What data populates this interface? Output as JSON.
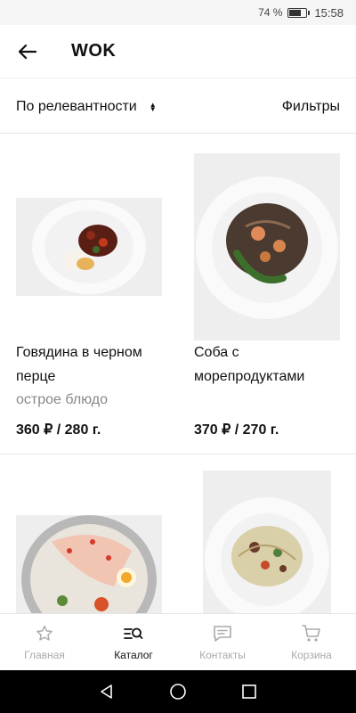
{
  "status_bar": {
    "battery_pct": "74 %",
    "battery_level": 0.74,
    "time": "15:58"
  },
  "header": {
    "title": "WOK"
  },
  "sort": {
    "label": "По релевантности",
    "filters_label": "Фильтры"
  },
  "products": [
    {
      "title_line1": "Говядина в черном",
      "title_line2": "перце",
      "subtitle": "острое блюдо",
      "price": "360 ₽ / 280 г."
    },
    {
      "title_line1": "Соба с",
      "title_line2": "морепродуктами",
      "subtitle": "",
      "price": "370 ₽ / 270 г."
    },
    {
      "title_line1": "",
      "title_line2": "",
      "subtitle": "",
      "price": ""
    },
    {
      "title_line1": "",
      "title_line2": "",
      "subtitle": "",
      "price": ""
    }
  ],
  "bottom_nav": [
    {
      "label": "Главная",
      "icon": "star-icon",
      "active": false
    },
    {
      "label": "Каталог",
      "icon": "catalog-icon",
      "active": true
    },
    {
      "label": "Контакты",
      "icon": "chat-icon",
      "active": false
    },
    {
      "label": "Корзина",
      "icon": "cart-icon",
      "active": false
    }
  ],
  "colors": {
    "accent": "#111111",
    "inactive": "#aaaaaa",
    "divider": "#e5e5e5"
  }
}
